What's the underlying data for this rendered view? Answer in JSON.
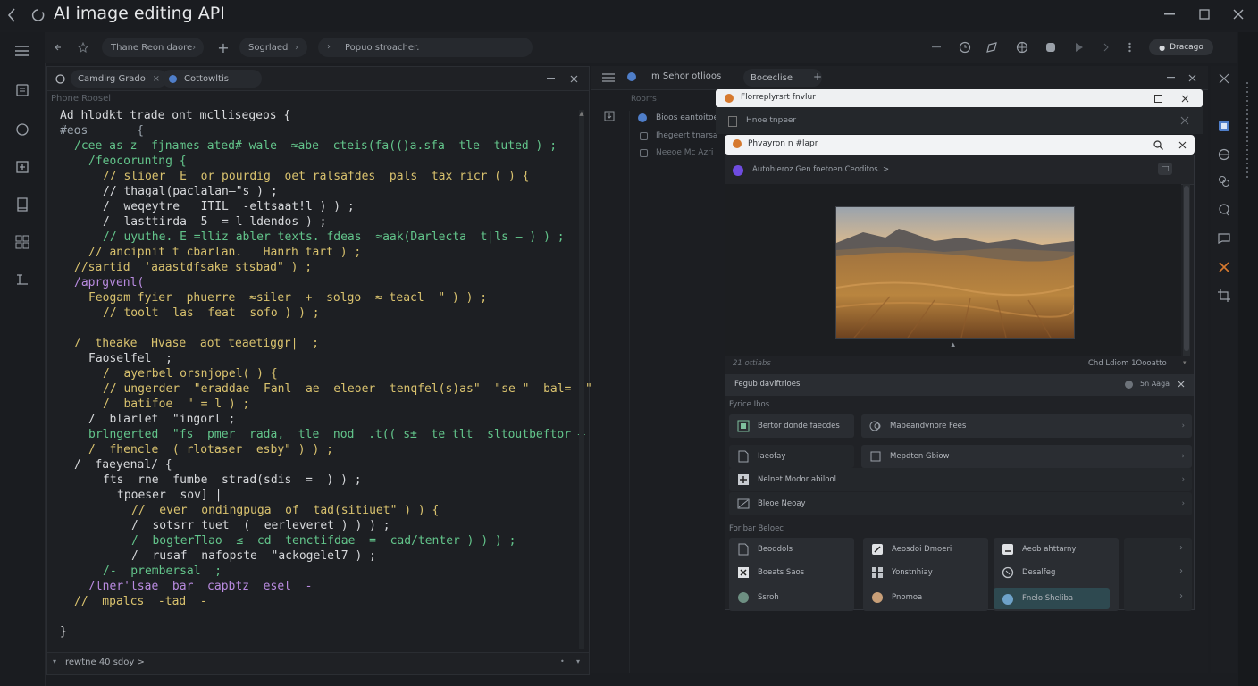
{
  "app": {
    "title": "AI image editing API"
  },
  "toolbar": {
    "path1": "Thane Reon daore",
    "path2": "Sogrlaed",
    "search_placeholder": "Popuo stroacher.",
    "right_button": "Dracago"
  },
  "editor": {
    "tabs": [
      {
        "label": "Camdirg Grado"
      },
      {
        "label": "Cottowltis"
      }
    ],
    "breadcrumb": "Phone Roosel",
    "lines": [
      {
        "text": "Ad hlodkt trade ont mcllisegeos {",
        "color": "w",
        "indent": 0
      },
      {
        "text": "#eos       {",
        "color": "c",
        "indent": 0
      },
      {
        "text": "/cee as z  fjnames ated# wale  ≈abe  cteis(fa(()a.sfa  tle  tuted ) ;",
        "color": "g",
        "indent": 1
      },
      {
        "text": "/feocoruntng {",
        "color": "g",
        "indent": 2
      },
      {
        "text": "// slioer  E  or pourdig  oet ralsafdes  pals  tax ricr ( ) {",
        "color": "y",
        "indent": 3
      },
      {
        "text": "// thagal(paclalan–\"s ) ;",
        "color": "w",
        "indent": 3
      },
      {
        "text": "/  weqeytre   ITIL  -eltsaat!l ) ) ;",
        "color": "w",
        "indent": 3
      },
      {
        "text": "/  lasttirda  5  = l ldendos ) ;",
        "color": "w",
        "indent": 3
      },
      {
        "text": "// uyuthe. E =lliz abler texts. fdeas  ≈aak(Darlecta  t|ls – ) ) ;",
        "color": "g",
        "indent": 3
      },
      {
        "text": "// ancipnit t cbarlan.   Hanrh tart ) ;",
        "color": "y",
        "indent": 2
      },
      {
        "text": "//sartid  'aaastdfsake stsbad\" ) ;",
        "color": "y",
        "indent": 1
      },
      {
        "text": "/aprgvenl(",
        "color": "p",
        "indent": 1
      },
      {
        "text": "Feogam fyier  phuerre  ≈siler  +  solgo  ≈ teacl  \" ) ) ;",
        "color": "y",
        "indent": 2
      },
      {
        "text": "// toolt  las  feat  sofo ) ) ;",
        "color": "y",
        "indent": 3
      },
      {
        "text": "",
        "color": "w",
        "indent": 0
      },
      {
        "text": "/  theake  Hvase  aot teaetiggr|  ;",
        "color": "y",
        "indent": 1
      },
      {
        "text": "Faoselfel  ;",
        "color": "w",
        "indent": 2
      },
      {
        "text": "/  ayerbel orsnjopel( ) {",
        "color": "y",
        "indent": 3
      },
      {
        "text": "// ungerder  \"eraddae  Fanl  ae  eleoer  tenqfel(s)as\"  \"se \"  bal=  \" \" ) ) ;",
        "color": "y",
        "indent": 3
      },
      {
        "text": "/  batifoe  \" = l ) ;",
        "color": "y",
        "indent": 3
      },
      {
        "text": "/  blarlet  \"ingorl ;",
        "color": "w",
        "indent": 2
      },
      {
        "text": "brlngerted  \"fs  pmer  rada,  tle  nod  .t(( s±  te tlt  sltoutbeftor – ) ;",
        "color": "g",
        "indent": 2
      },
      {
        "text": "/  fhencle  ( rlotaser  esby\" ) ) ;",
        "color": "y",
        "indent": 2
      },
      {
        "text": "/  faeyenal/ {",
        "color": "w",
        "indent": 1
      },
      {
        "text": "fts  rne  fumbe  strad(sdis  =  ) ) ;",
        "color": "w",
        "indent": 3
      },
      {
        "text": "tpoeser  sov] |",
        "color": "w",
        "indent": 4
      },
      {
        "text": "//  ever  ondingpuga  of  tad(sitiuet\" ) ) {",
        "color": "y",
        "indent": 5
      },
      {
        "text": "/  sotsrr tuet  (  eerleveret ) ) ) ;",
        "color": "w",
        "indent": 5
      },
      {
        "text": "/  bogterTlao  ≤  cd  tenctifdae  =  cad/tenter ) ) ) ;",
        "color": "g",
        "indent": 5
      },
      {
        "text": "/  rusaf  nafopste  \"ackogelel7 ) ;",
        "color": "w",
        "indent": 5
      },
      {
        "text": "/-  prembersal  ;",
        "color": "g",
        "indent": 3
      },
      {
        "text": "/lner'lsae  bar  capbtz  esel  -",
        "color": "p",
        "indent": 2
      },
      {
        "text": "//  mpalcs  -tad  -",
        "color": "y",
        "indent": 1
      },
      {
        "text": "",
        "color": "w",
        "indent": 0
      },
      {
        "text": "}",
        "color": "w",
        "indent": 0
      }
    ],
    "footer": "rewtne  40  sdoy >"
  },
  "mid": {
    "tab_title": "Im Sehor otlioos",
    "tab_pill": "Boceclise",
    "section": "Roorrs",
    "items": [
      {
        "label": "Bioos eantoitoe"
      },
      {
        "label": "Ihegeert tnarsa"
      },
      {
        "label": "Neeoe Mc Azri"
      }
    ]
  },
  "window1": {
    "title": "Florreplyrsrt fnvlur",
    "subtitle": "Hnoe tnpeer"
  },
  "window2": {
    "search": "Phvayron n #lapr",
    "header": "Autohieroz Gen foetoen Ceoditos. >",
    "image_caption": "Golden grassland hills at sunset",
    "meta_left": "21 ottiabs",
    "meta_right": "Chd Ldiom 1Oooatto",
    "toolbar_label": "Fegub daviftrioes",
    "toolbar_value": "5n Aaga",
    "section1": "Fyrice  Ibos",
    "rows1": [
      {
        "left": "Bertor donde faecdes",
        "right": "Mabeandvnore Fees"
      },
      {
        "left": "Iaeofay",
        "right": "Mepdten Gbiow"
      },
      {
        "left": "Nelnet Modor abilool",
        "right": ""
      },
      {
        "left": "Bleoe Neoay",
        "right": ""
      }
    ],
    "section2": "Forlbar Beloec",
    "grid": [
      [
        "Beoddols",
        "Aeosdoi Dmoeri",
        "Aeob ahttarny"
      ],
      [
        "Boeats Saos",
        "Yonstnhiay",
        "Desalfeg"
      ],
      [
        "Ssroh",
        "Pnomoa",
        "Fnelo Sheliba"
      ]
    ]
  }
}
